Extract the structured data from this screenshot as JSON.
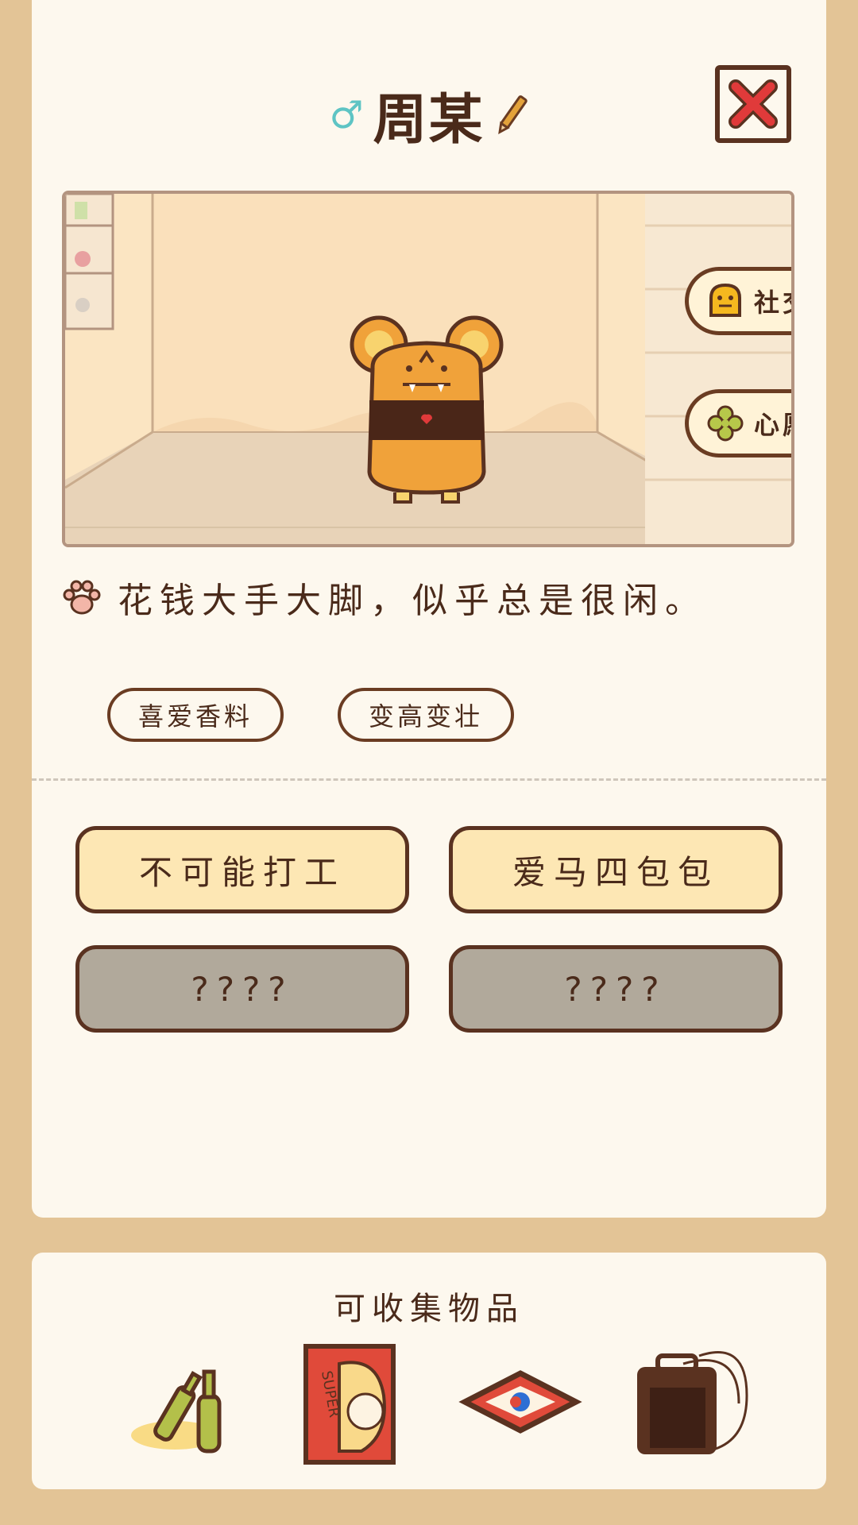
{
  "header": {
    "gender_symbol": "♂",
    "name": "周某"
  },
  "scene": {
    "side_buttons": [
      {
        "label": "社交",
        "icon": "monster-face-icon"
      },
      {
        "label": "心愿",
        "icon": "clover-icon"
      }
    ]
  },
  "description": "花钱大手大脚，似乎总是很闲。",
  "tags": [
    "喜爱香料",
    "变高变壮"
  ],
  "traits": [
    {
      "label": "不可能打工",
      "state": "unlocked"
    },
    {
      "label": "爱马四包包",
      "state": "unlocked"
    },
    {
      "label": "????",
      "state": "locked"
    },
    {
      "label": "????",
      "state": "locked"
    }
  ],
  "collectibles": {
    "title": "可收集物品",
    "items": [
      {
        "icon": "bottles-icon"
      },
      {
        "icon": "poster-icon",
        "poster_text": "SUPER"
      },
      {
        "icon": "rug-icon"
      },
      {
        "icon": "guitar-amp-icon"
      }
    ]
  },
  "colors": {
    "background": "#e3c496",
    "card": "#fdf8ee",
    "outline": "#5a3220",
    "button_unlocked": "#fde7b4",
    "button_locked": "#b1a99b",
    "close_x": "#e03a3a",
    "gender": "#5ec4c4"
  }
}
